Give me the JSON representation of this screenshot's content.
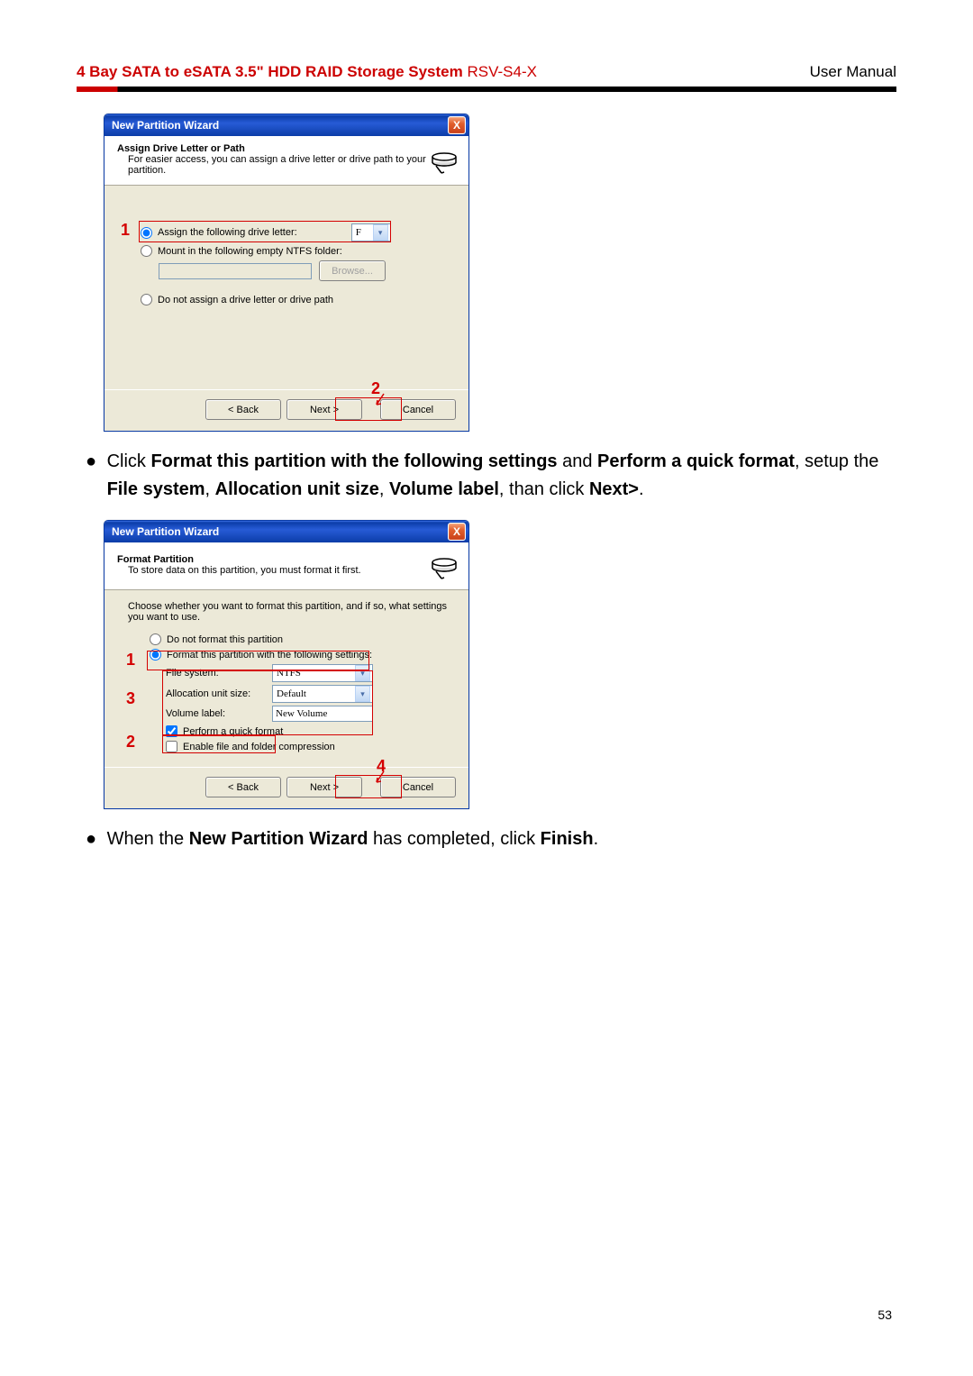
{
  "header": {
    "title_bold": "4 Bay SATA to eSATA 3.5\" HDD RAID Storage System",
    "title_model": " RSV-S4-X",
    "right": "User Manual"
  },
  "dialog1": {
    "title": "New Partition Wizard",
    "close": "X",
    "head_title": "Assign Drive Letter or Path",
    "head_sub": "For easier access, you can assign a drive letter or drive path to your partition.",
    "opt_assign": "Assign the following drive letter:",
    "drive_letter": "F",
    "opt_mount": "Mount in the following empty NTFS folder:",
    "browse": "Browse...",
    "opt_none": "Do not assign a drive letter or drive path",
    "btn_back": "< Back",
    "btn_next": "Next >",
    "btn_cancel": "Cancel",
    "ann1": "1",
    "ann2": "2"
  },
  "para1": {
    "pre": "Click ",
    "b1": "Format this partition with the following settings",
    "mid1": " and ",
    "b2": "Perform a quick format",
    "mid2": ", setup the ",
    "b3": "File system",
    "c1": ", ",
    "b4": "Allocation unit size",
    "c2": ", ",
    "b5": "Volume label",
    "mid3": ", than click ",
    "b6": "Next>",
    "end": "."
  },
  "dialog2": {
    "title": "New Partition Wizard",
    "close": "X",
    "head_title": "Format Partition",
    "head_sub": "To store data on this partition, you must format it first.",
    "intro": "Choose whether you want to format this partition, and if so, what settings you want to use.",
    "opt_noformat": "Do not format this partition",
    "opt_format": "Format this partition with the following settings:",
    "lbl_fs": "File system:",
    "val_fs": "NTFS",
    "lbl_au": "Allocation unit size:",
    "val_au": "Default",
    "lbl_vl": "Volume label:",
    "val_vl": "New Volume",
    "chk_quick": "Perform a quick format",
    "chk_compress": "Enable file and folder compression",
    "btn_back": "< Back",
    "btn_next": "Next >",
    "btn_cancel": "Cancel",
    "ann1": "1",
    "ann2": "2",
    "ann3": "3",
    "ann4": "4"
  },
  "para2": {
    "pre": "When the ",
    "b1": "New Partition Wizard",
    "mid": " has completed, click ",
    "b2": "Finish",
    "end": "."
  },
  "page_number": "53"
}
